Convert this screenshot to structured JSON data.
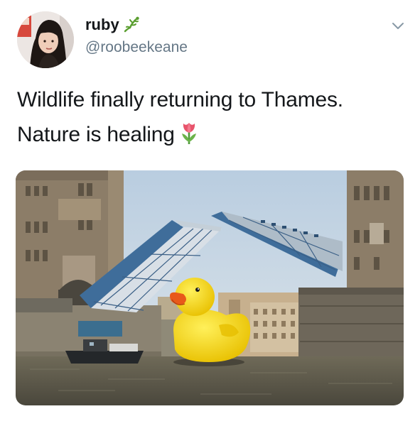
{
  "user": {
    "display_name": "ruby",
    "handle": "@roobeekeane",
    "name_emoji_icon": "lizard-icon",
    "avatar": "avatar-photo"
  },
  "tweet": {
    "lines": [
      "Wildlife finally returning to Thames.",
      "Nature is healing"
    ],
    "trailing_emoji_icon": "tulip-icon"
  },
  "menu": {
    "icon": "chevron-down-icon"
  },
  "media": {
    "description_icon": "photo"
  },
  "colors": {
    "text": "#14171a",
    "secondary": "#657786",
    "duck": "#f7d81b",
    "beak": "#e8591a",
    "bridge_blue": "#3f6d9a",
    "water": "#5d5a4b"
  }
}
